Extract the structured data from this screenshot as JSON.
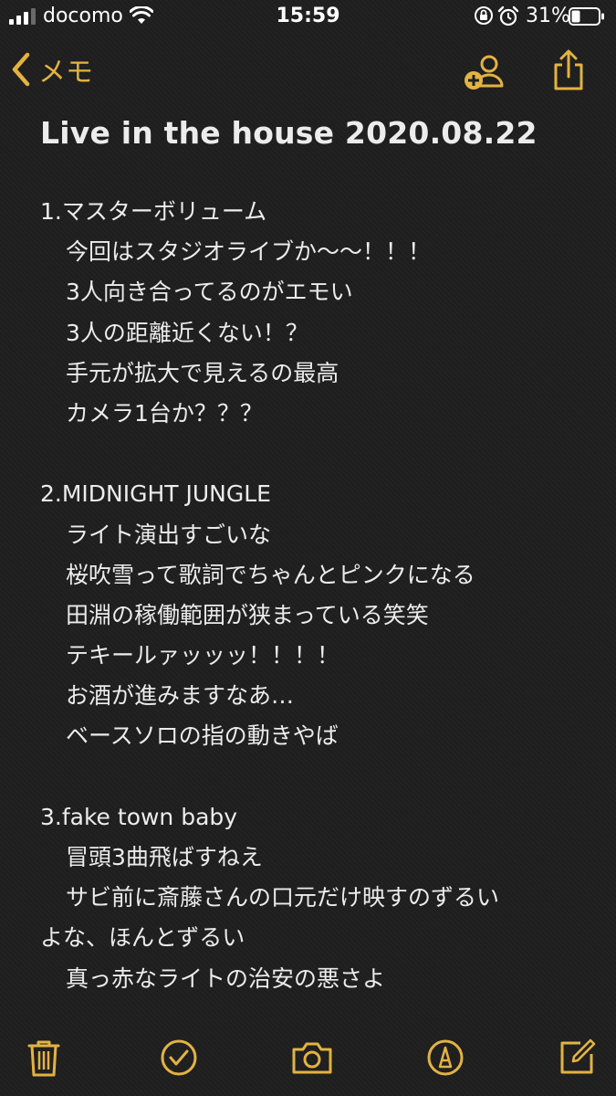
{
  "status_bar": {
    "carrier": "docomo",
    "time": "15:59",
    "battery_percent": "31%",
    "battery_level": 0.31,
    "icons": [
      "signal-icon",
      "wifi-icon",
      "orientation-lock-icon",
      "alarm-icon",
      "battery-icon"
    ]
  },
  "nav": {
    "back_label": "メモ",
    "icons": [
      "chevron-left-icon",
      "add-person-icon",
      "share-icon"
    ]
  },
  "note": {
    "title": "Live in the house 2020.08.22",
    "lines": [
      {
        "text": "1.マスターボリューム",
        "indent": false
      },
      {
        "text": "今回はスタジオライブか〜〜！！！",
        "indent": true
      },
      {
        "text": "3人向き合ってるのがエモい",
        "indent": true
      },
      {
        "text": "3人の距離近くない！？",
        "indent": true
      },
      {
        "text": "手元が拡大で見えるの最高",
        "indent": true
      },
      {
        "text": "カメラ1台か？？？",
        "indent": true
      },
      {
        "text": "",
        "indent": false
      },
      {
        "text": "2.MIDNIGHT JUNGLE",
        "indent": false
      },
      {
        "text": "ライト演出すごいな",
        "indent": true
      },
      {
        "text": "桜吹雪って歌詞でちゃんとピンクになる",
        "indent": true
      },
      {
        "text": "田淵の稼働範囲が狭まっている笑笑",
        "indent": true
      },
      {
        "text": "テキールァッッッ！！！！",
        "indent": true
      },
      {
        "text": "お酒が進みますなあ…",
        "indent": true
      },
      {
        "text": "ベースソロの指の動きやば",
        "indent": true
      },
      {
        "text": "",
        "indent": false
      },
      {
        "text": "3.fake town baby",
        "indent": false
      },
      {
        "text": "冒頭3曲飛ばすねえ",
        "indent": true
      },
      {
        "text": "サビ前に斎藤さんの口元だけ映すのずるい",
        "indent": true
      },
      {
        "text": "よな、ほんとずるい",
        "indent": false
      },
      {
        "text": "真っ赤なライトの治安の悪さよ",
        "indent": true
      }
    ]
  },
  "toolbar": {
    "icons": [
      "trash-icon",
      "checklist-icon",
      "camera-icon",
      "markup-icon",
      "compose-icon"
    ]
  },
  "colors": {
    "accent": "#e3b341",
    "background": "#1f1f1f",
    "text": "#ececec"
  }
}
